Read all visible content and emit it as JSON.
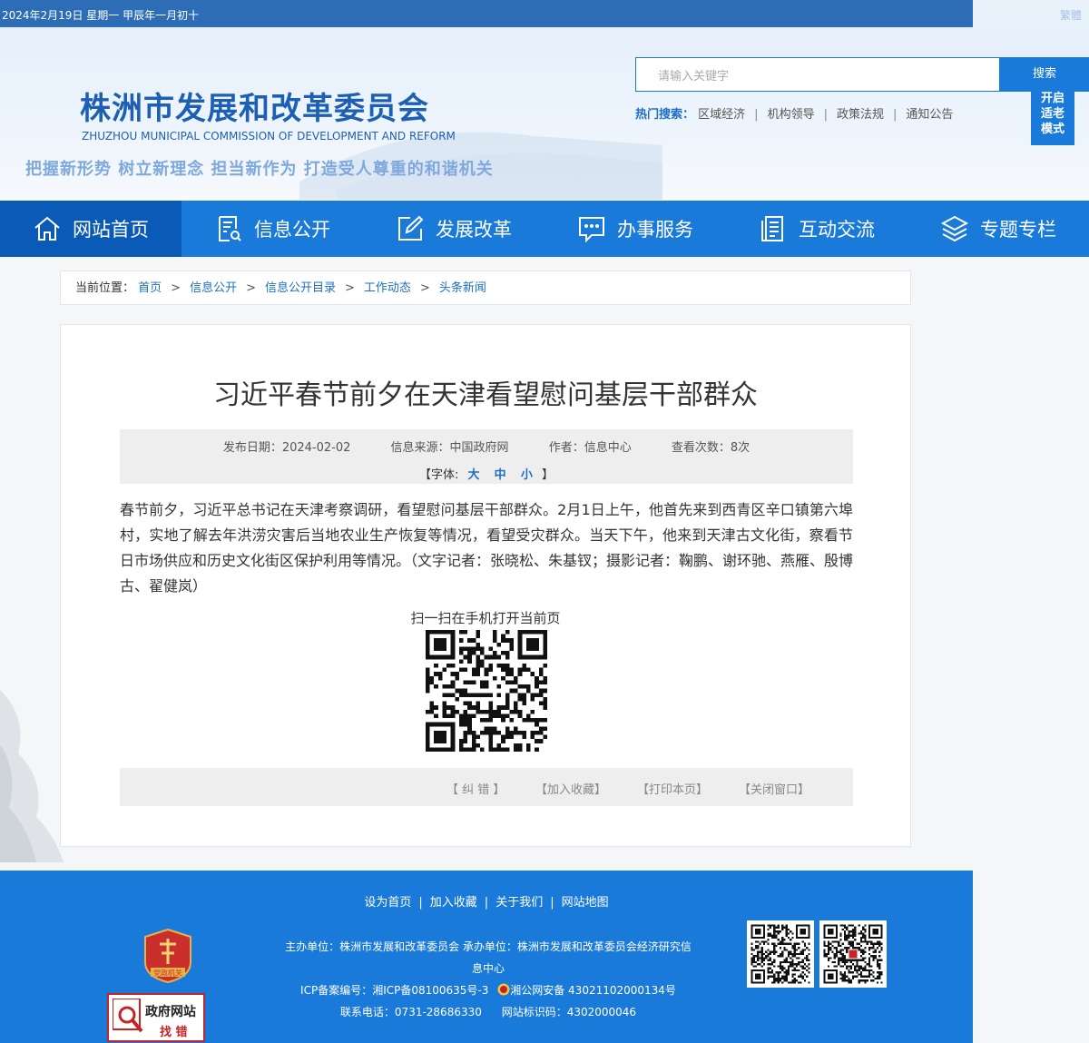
{
  "topbar": {
    "date": "2024年2月19日  星期一  甲辰年一月初十",
    "traditional": "繁體"
  },
  "header": {
    "title": "株洲市发展和改革委员会",
    "subtitle": "ZHUZHOU MUNICIPAL COMMISSION OF DEVELOPMENT AND REFORM",
    "slogan": "把握新形势 树立新理念 担当新作为 打造受人尊重的和谐机关",
    "search_placeholder": "请输入关键字",
    "search_button": "搜索",
    "hot_label": "热门搜索：",
    "hot_items": [
      "区域经济",
      "机构领导",
      "政策法规",
      "通知公告"
    ],
    "elder_mode": [
      "开启",
      "适老",
      "模式"
    ]
  },
  "nav": [
    {
      "label": "网站首页",
      "icon": "home-icon"
    },
    {
      "label": "信息公开",
      "icon": "document-search-icon"
    },
    {
      "label": "发展改革",
      "icon": "edit-icon"
    },
    {
      "label": "办事服务",
      "icon": "chat-icon"
    },
    {
      "label": "互动交流",
      "icon": "document-list-icon"
    },
    {
      "label": "专题专栏",
      "icon": "layers-icon"
    }
  ],
  "breadcrumb": {
    "label": "当前位置：",
    "items": [
      "首页",
      "信息公开",
      "信息公开目录",
      "工作动态",
      "头条新闻"
    ]
  },
  "article": {
    "title": "习近平春节前夕在天津看望慰问基层干部群众",
    "publish_date": "发布日期：2024-02-02",
    "source": "信息来源：中国政府网",
    "author": "作者：信息中心",
    "views": "查看次数：8次",
    "font_label": "【字体:",
    "font_large": "大",
    "font_medium": "中",
    "font_small": "小",
    "font_close": "】",
    "body": "春节前夕，习近平总书记在天津考察调研，看望慰问基层干部群众。2月1日上午，他首先来到西青区辛口镇第六埠村，实地了解去年洪涝灾害后当地农业生产恢复等情况，看望受灾群众。当天下午，他来到天津古文化街，察看节日市场供应和历史文化街区保护利用等情况。（文字记者：张晓松、朱基钗；摄影记者：鞠鹏、谢环驰、燕雁、殷博古、翟健岚）",
    "qr_label": "扫一扫在手机打开当前页",
    "tools": [
      "【 纠 错 】",
      "【加入收藏】",
      "【打印本页】",
      "【关闭窗口】"
    ]
  },
  "footer": {
    "links": [
      "设为首页",
      "加入收藏",
      "关于我们",
      "网站地图"
    ],
    "sponsor": "主办单位：株洲市发展和改革委员会 承办单位：株洲市发展和改革委员会经济研究信息中心",
    "icp": "ICP备案编号：湘ICP备08100635号-3",
    "police": "湘公网安备 43021102000134号",
    "phone": "联系电话：0731-28686330",
    "site_id": "网站标识码：4302000046",
    "emblem_text": "党政机关",
    "fix_line1": "政府网站",
    "fix_line2": "找 错"
  },
  "colors": {
    "primary": "#1a7ad9",
    "nav_active": "#0a5bb8",
    "link": "#1d6fc6",
    "topbar": "#2d6db5"
  }
}
